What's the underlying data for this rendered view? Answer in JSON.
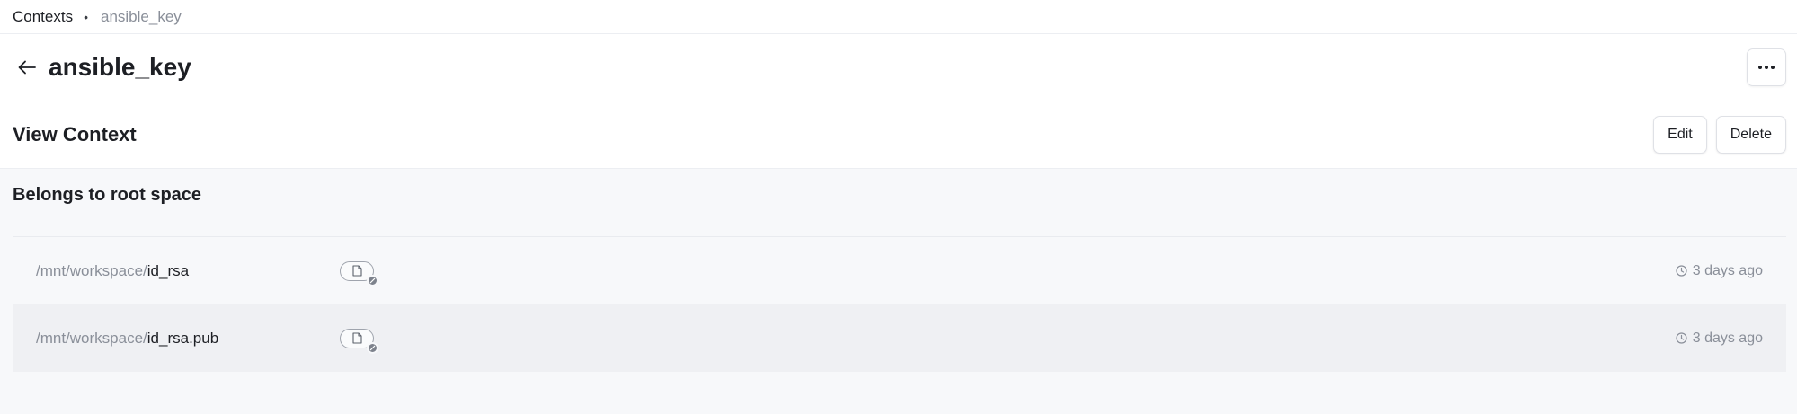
{
  "breadcrumb": {
    "root": "Contexts",
    "separator": "•",
    "current": "ansible_key"
  },
  "header": {
    "title": "ansible_key",
    "back_icon": "arrow-left-icon",
    "more_icon": "ellipsis-icon"
  },
  "view": {
    "title": "View Context",
    "edit_label": "Edit",
    "delete_label": "Delete"
  },
  "space": {
    "label": "Belongs to root space"
  },
  "mounts": [
    {
      "prefix": "/mnt/workspace/",
      "name": "id_rsa",
      "icon": "file-icon",
      "badge_icon": "lock-icon",
      "time": "3 days ago"
    },
    {
      "prefix": "/mnt/workspace/",
      "name": "id_rsa.pub",
      "icon": "file-icon",
      "badge_icon": "lock-icon",
      "time": "3 days ago"
    }
  ],
  "colors": {
    "text": "#1d1f24",
    "muted": "#8a8f99",
    "content_bg": "#f7f8fa",
    "row_alt_bg": "#eff0f3",
    "border": "#dfe1e6"
  }
}
